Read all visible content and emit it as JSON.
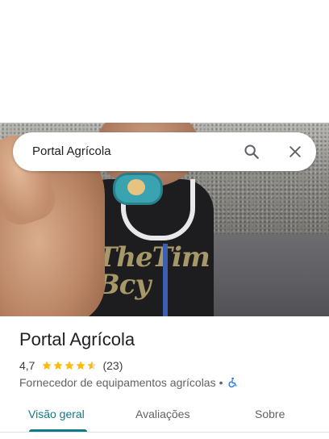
{
  "search": {
    "query": "Portal Agrícola",
    "search_icon": "search-icon",
    "close_icon": "close-icon"
  },
  "photo": {
    "shirt_print": "TheTim",
    "shirt_print_2": "Bcy"
  },
  "place": {
    "name": "Portal Agrícola",
    "rating": "4,7",
    "rating_value": 4.7,
    "reviews": "(23)",
    "category": "Fornecedor de equipamentos agrícolas",
    "separator": "•",
    "accessibility_icon": "wheelchair-icon"
  },
  "tabs": [
    {
      "label": "Visão geral",
      "active": true
    },
    {
      "label": "Avaliações",
      "active": false
    },
    {
      "label": "Sobre",
      "active": false
    }
  ],
  "colors": {
    "accent": "#0f7a86",
    "star": "#fbbc04",
    "accessibility": "#1a73e8"
  }
}
